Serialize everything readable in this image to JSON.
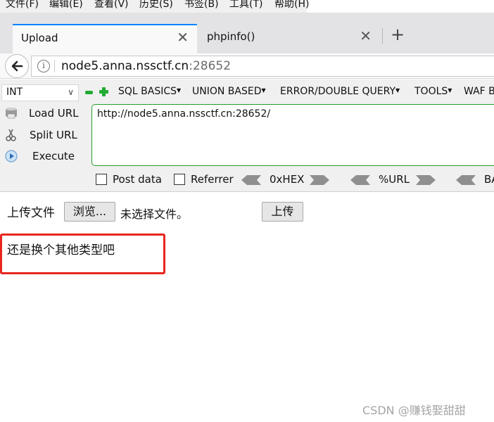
{
  "menubar": [
    "文件(F)",
    "编辑(E)",
    "查看(V)",
    "历史(S)",
    "书签(B)",
    "工具(T)",
    "帮助(H)"
  ],
  "tabs": [
    {
      "label": "Upload",
      "active": true
    },
    {
      "label": "phpinfo()",
      "active": false
    }
  ],
  "new_tab_glyph": "+",
  "address": {
    "host": "node5.anna.nssctf.cn",
    "port": ":28652"
  },
  "hackbar": {
    "type_select": "INT",
    "menus": [
      "SQL BASICS",
      "UNION BASED",
      "ERROR/DOUBLE QUERY",
      "TOOLS",
      "WAF B"
    ],
    "load_url": "Load URL",
    "split_url": "Split URL",
    "execute": "Execute",
    "url_value": "http://node5.anna.nssctf.cn:28652/",
    "post_data": "Post data",
    "referrer": "Referrer",
    "hex": "0xHEX",
    "url_enc": "%URL",
    "base_partial": "BA",
    "accent_color": "#22aa33"
  },
  "page": {
    "upload_label": "上传文件",
    "browse_button": "浏览...",
    "no_file": "未选择文件。",
    "submit_button": "上传",
    "message": "还是换个其他类型吧",
    "highlight_color": "#e8261f"
  },
  "watermark": "CSDN @赚钱娶甜甜"
}
